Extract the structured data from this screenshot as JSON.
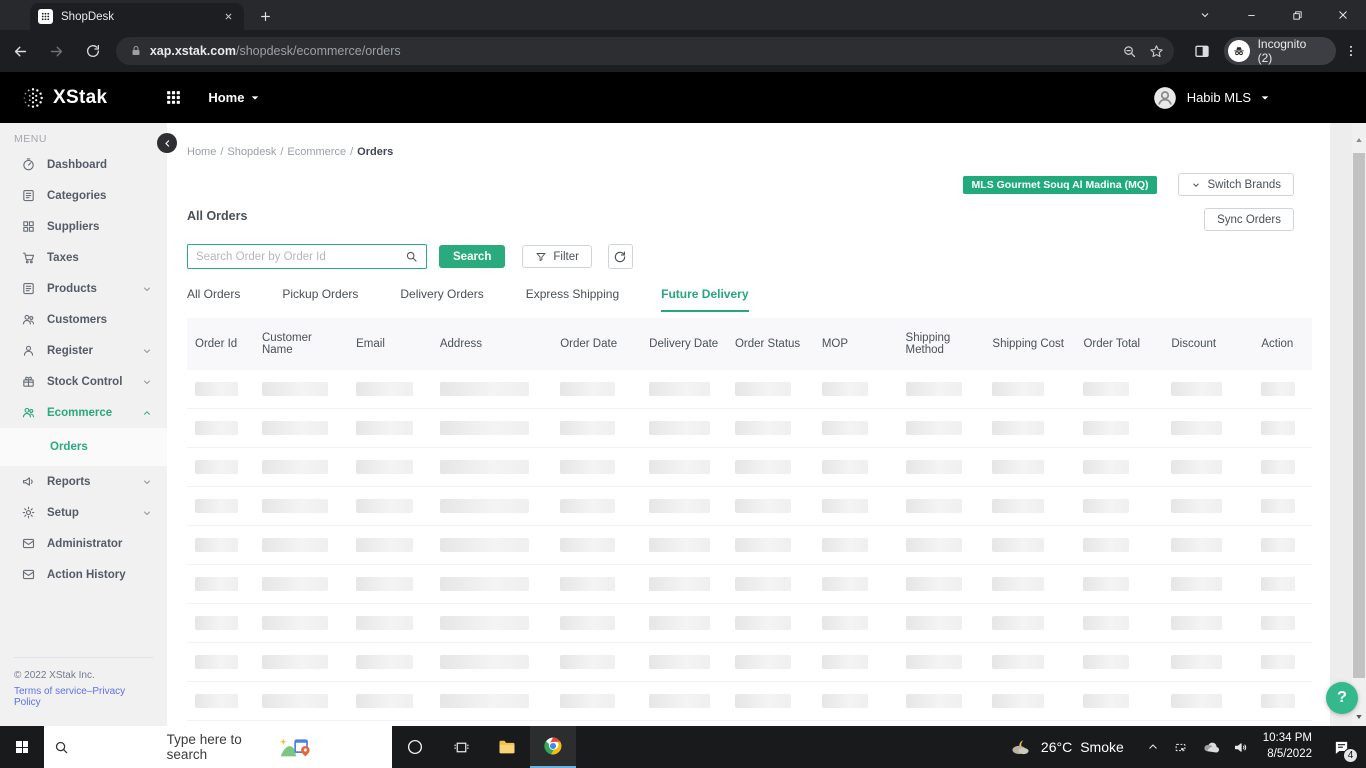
{
  "browser": {
    "tab_title": "ShopDesk",
    "url_host": "xap.xstak.com",
    "url_path": "/shopdesk/ecommerce/orders",
    "incognito_label": "Incognito (2)"
  },
  "app_header": {
    "brand": "XStak",
    "nav_home": "Home",
    "user": "Habib MLS"
  },
  "sidebar": {
    "menu_label": "MENU",
    "items": [
      {
        "label": "Dashboard",
        "icon": "dashboard-icon"
      },
      {
        "label": "Categories",
        "icon": "categories-icon"
      },
      {
        "label": "Suppliers",
        "icon": "suppliers-icon"
      },
      {
        "label": "Taxes",
        "icon": "taxes-icon"
      },
      {
        "label": "Products",
        "icon": "products-icon",
        "chevron": "down"
      },
      {
        "label": "Customers",
        "icon": "customers-icon"
      },
      {
        "label": "Register",
        "icon": "register-icon",
        "chevron": "down"
      },
      {
        "label": "Stock Control",
        "icon": "stock-control-icon",
        "chevron": "down"
      },
      {
        "label": "Ecommerce",
        "icon": "ecommerce-icon",
        "chevron": "up",
        "active": true,
        "submenu": [
          {
            "label": "Orders",
            "active": true
          }
        ]
      },
      {
        "label": "Reports",
        "icon": "reports-icon",
        "chevron": "down"
      },
      {
        "label": "Setup",
        "icon": "setup-icon",
        "chevron": "down"
      },
      {
        "label": "Administrator",
        "icon": "administrator-icon"
      },
      {
        "label": "Action History",
        "icon": "action-history-icon"
      }
    ],
    "footer": {
      "copyright": "© 2022 XStak Inc.",
      "terms": "Terms of service",
      "separator": "–",
      "privacy": "Privacy Policy"
    }
  },
  "main": {
    "breadcrumb": [
      "Home",
      "Shopdesk",
      "Ecommerce",
      "Orders"
    ],
    "brand_badge": "MLS Gourmet Souq Al Madina (MQ)",
    "buttons": {
      "switch_brands": "Switch Brands",
      "sync_orders": "Sync Orders"
    },
    "section_title": "All Orders",
    "search": {
      "placeholder": "Search Order by Order Id",
      "value": "",
      "button": "Search",
      "filter": "Filter"
    },
    "tabs": [
      {
        "label": "All Orders"
      },
      {
        "label": "Pickup Orders"
      },
      {
        "label": "Delivery Orders"
      },
      {
        "label": "Express Shipping"
      },
      {
        "label": "Future Delivery",
        "active": true
      }
    ],
    "table": {
      "columns": [
        "Order Id",
        "Customer Name",
        "Email",
        "Address",
        "Order Date",
        "Delivery Date",
        "Order Status",
        "MOP",
        "Shipping Method",
        "Shipping Cost",
        "Order Total",
        "Discount",
        "Action"
      ],
      "skeleton_rows": 10
    },
    "help_label": "?"
  },
  "taskbar": {
    "search_placeholder": "Type here to search",
    "weather": {
      "temp": "26°C",
      "desc": "Smoke"
    },
    "clock": {
      "time": "10:34 PM",
      "date": "8/5/2022"
    },
    "notification_count": "4"
  },
  "colors": {
    "primary_green": "#2aab7e",
    "badge_green": "#21ab7d",
    "help_green": "#34b98c",
    "link_blue": "#5b73e8",
    "chrome_dark": "#1d1e22",
    "tabstrip": "#28292d",
    "taskbar": "#191a1b"
  }
}
